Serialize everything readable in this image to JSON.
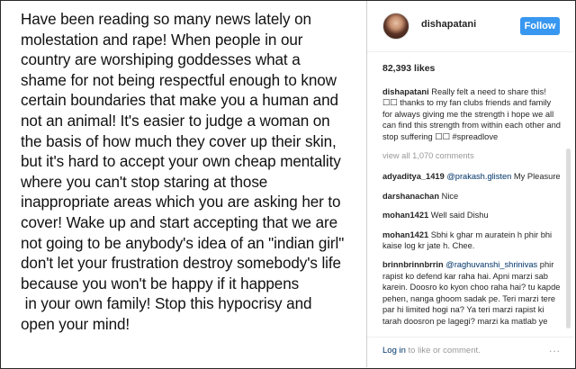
{
  "post": {
    "text": "Have been reading so many news lately on\nmolestation and rape! When people in our\ncountry are worshiping goddesses what a\nshame for not being respectful enough to know\ncertain boundaries that make you a human and\nnot an animal! It's easier to judge a woman on\nthe basis of how much they cover up their skin,\nbut it's hard to accept your own cheap mentality\nwhere you can't stop staring at those\ninappropriate areas which you are asking her to\ncover! Wake up and start accepting that we are\nnot going to be anybody's idea of an \"indian girl\"\ndon't let your frustration destroy somebody's life\nbecause you won't be happy if it happens\n in your own family! Stop this hypocrisy and\nopen your mind!"
  },
  "header": {
    "username": "dishapatani",
    "follow_label": "Follow"
  },
  "likes": "82,393 likes",
  "caption": {
    "user": "dishapatani",
    "text": " Really felt a need to share this! ☐☐ thanks to my fan clubs friends and family for always giving me the strength i hope we all can find this strength from within each other and stop suffering ☐☐ #spreadlove"
  },
  "view_all": "view all 1,070 comments",
  "comments": [
    {
      "user": "adyaditya_1419",
      "mention": "@prakash.glisten",
      "text": " My Pleasure"
    },
    {
      "user": "darshanachan",
      "mention": "",
      "text": " Nice"
    },
    {
      "user": "mohan1421",
      "mention": "",
      "text": " Well said Dishu"
    },
    {
      "user": "mohan1421",
      "mention": "",
      "text": " Sbhi k ghar m auratein h phir bhi kaise log kr jate h. Chee."
    },
    {
      "user": "brinnbrinnbrrin",
      "mention": "@raghuvanshi_shrinivas",
      "text": " phir rapist ko defend kar raha hai. Apni marzi sab karein. Doosro ko kyon choo raha hai? tu kapde pehen, nanga ghoom sadak pe. Teri marzi tere par hi limited hogi na? Ya teri marzi rapist ki tarah doosron pe lagegi? marzi ka matlab ye"
    }
  ],
  "footer": {
    "login_link": "Log in",
    "login_rest": " to like or comment.",
    "more": "..."
  }
}
